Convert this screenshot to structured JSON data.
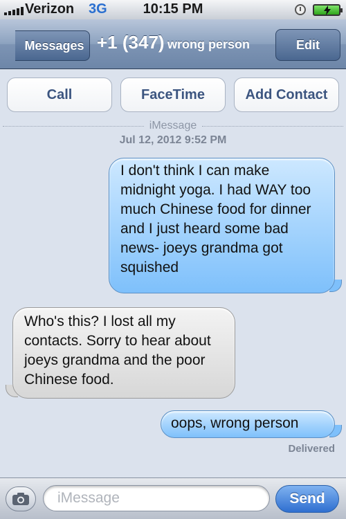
{
  "status_bar": {
    "carrier": "Verizon",
    "network": "3G",
    "time": "10:15 PM",
    "icons": [
      "signal-bars-icon",
      "alarm-icon",
      "battery-charging-icon"
    ]
  },
  "nav_bar": {
    "back_label": "Messages",
    "title_number": "+1 (347)",
    "title_name": "wrong person",
    "edit_label": "Edit"
  },
  "actions": {
    "call_label": "Call",
    "facetime_label": "FaceTime",
    "add_contact_label": "Add Contact"
  },
  "thread": {
    "service_label": "iMessage",
    "timestamp": "Jul 12, 2012 9:52 PM",
    "messages": [
      {
        "direction": "outgoing",
        "text": "I don't think I can make midnight yoga. I had WAY too much Chinese food for dinner and I just heard some bad news- joeys grandma got squished"
      },
      {
        "direction": "incoming",
        "text": "Who's this? I lost all my contacts. Sorry to hear about joeys grandma and the poor Chinese food."
      },
      {
        "direction": "outgoing",
        "text": "oops, wrong person"
      }
    ],
    "delivery_status": "Delivered"
  },
  "composer": {
    "placeholder": "iMessage",
    "send_label": "Send"
  },
  "colors": {
    "nav_bar": "#7d94b4",
    "outgoing_bubble": "#7ec0fb",
    "incoming_bubble": "#d7d7d7",
    "send_button": "#2f6fd0",
    "background": "#dbe2ed"
  }
}
